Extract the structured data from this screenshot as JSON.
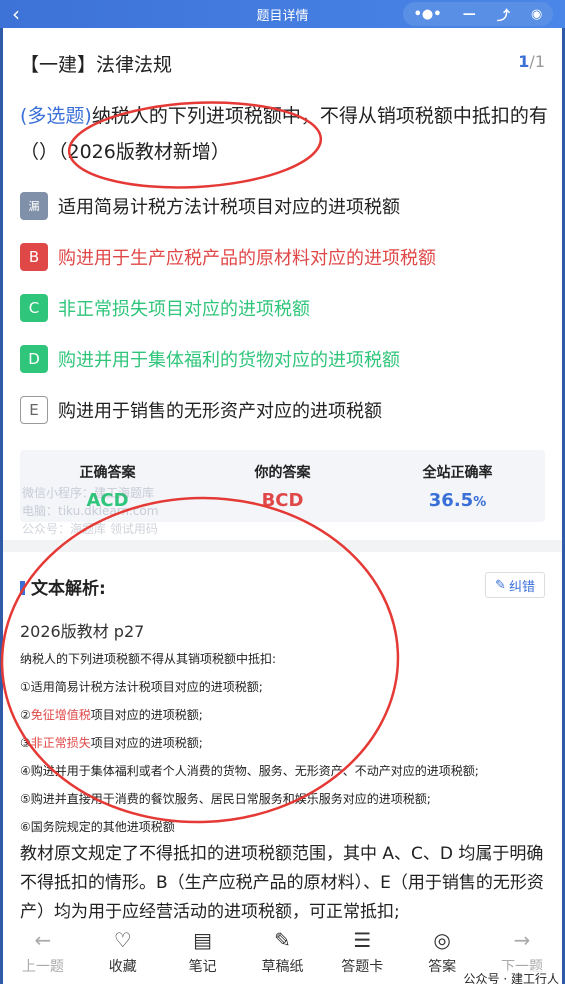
{
  "topbar": {
    "back_icon": "chevron-left-icon",
    "title": "题目详情",
    "more_icon": "•●•",
    "minimize_icon": "—",
    "restore_icon": "⤴",
    "close_icon": "◉"
  },
  "header": {
    "title": "【一建】法律法规",
    "current": "1",
    "sep_total": "/1"
  },
  "question": {
    "type": "(多选题)",
    "text": "纳税人的下列进项税额中，不得从销项税额中抵扣的有（）（2026版教材新增）"
  },
  "options": [
    {
      "badge": "漏",
      "text": "适用简易计税方法计税项目对应的进项税额",
      "state": "missed"
    },
    {
      "badge": "B",
      "text": "购进用于生产应税产品的原材料对应的进项税额",
      "state": "wrong"
    },
    {
      "badge": "C",
      "text": "非正常损失项目对应的进项税额",
      "state": "right"
    },
    {
      "badge": "D",
      "text": "购进并用于集体福利的货物对应的进项税额",
      "state": "right"
    },
    {
      "badge": "E",
      "text": "购进用于销售的无形资产对应的进项税额",
      "state": "plain"
    }
  ],
  "stats": {
    "correct_label": "正确答案",
    "correct_value": "ACD",
    "your_label": "你的答案",
    "your_value": "BCD",
    "rate_label": "全站正确率",
    "rate_value": "36.5",
    "rate_unit": "%"
  },
  "watermark": {
    "line1": "微信小程序：建工海题库",
    "line2": "电脑：tiku.dklearn.com",
    "line3": "公众号：海题库 领试用码"
  },
  "analysis": {
    "title": "文本解析:",
    "report_label": "纠错",
    "edition": "2026版教材 p27",
    "intro": "纳税人的下列进项税额不得从其销项税额中抵扣:",
    "l1": "①适用简易计税方法计税项目对应的进项税额;",
    "l2_pre": "②",
    "l2_red": "免征增值税",
    "l2_post": "项目对应的进项税额;",
    "l3_pre": "③",
    "l3_red": "非正常损失",
    "l3_post": "项目对应的进项税额;",
    "l4": "④购进并用于集体福利或者个人消费的货物、服务、无形资产、不动产对应的进项税额;",
    "l5": "⑤购进并直接用于消费的餐饮服务、居民日常服务和娱乐服务对应的进项税额;",
    "l6": "⑥国务院规定的其他进项税额",
    "para": "教材原文规定了不得抵扣的进项税额范围，其中 A、C、D 均属于明确不得抵扣的情形。B（生产应税产品的原材料）、E（用于销售的无形资产）均为用于应经营活动的进项税额，可正常抵扣;"
  },
  "bottom": [
    {
      "label": "上一题",
      "icon": "←"
    },
    {
      "label": "收藏",
      "icon": "♡"
    },
    {
      "label": "笔记",
      "icon": "▤"
    },
    {
      "label": "草稿纸",
      "icon": "✎"
    },
    {
      "label": "答题卡",
      "icon": "☰"
    },
    {
      "label": "答案",
      "icon": "◎"
    },
    {
      "label": "下一题",
      "icon": "→"
    }
  ],
  "account": "公众号 · 建工行人",
  "colors": {
    "accent": "#3a6fd8",
    "right": "#2fc57a",
    "wrong": "#e04848",
    "annotation": "#e53935"
  }
}
